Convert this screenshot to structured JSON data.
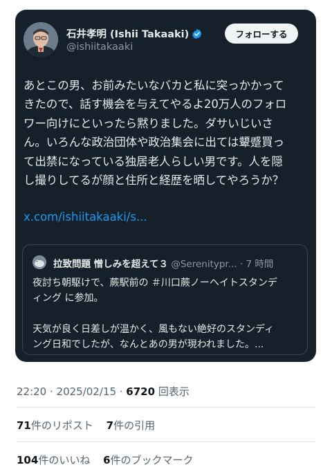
{
  "tweet": {
    "author": {
      "name": "石井孝明 (Ishii Takaaki)",
      "handle": "@ishiitakaaki",
      "verified_icon": "verified-badge-icon"
    },
    "follow_label": "フォローする",
    "text": "あとこの男、お前みたいなバカと私に突っかかって\nきたので、話す機会を与えてやるよ20万人のフォロ\nワー向けにといったら黙りました。ダサいじいさ\nん。いろんな政治団体や政治集会に出ては顰蹙買っ\nて出禁になっている独居老人らしい男です。人を隠\nし撮りしてるが顔と住所と経歴を晒してやろうか？",
    "link": "x.com/ishiitakaaki/s...",
    "quote": {
      "name": "拉致問題 憎しみを超えて３",
      "handle": "@Serenitypr...",
      "separator": "·",
      "time": "7 時間",
      "text": "夜討ち朝駆けで、蕨駅前の ＃川口蕨ノーヘイトスタンデ\nィング に参加。\n\n天気が良く日差しが温かく、風もない絶好のスタンディ\nング日和でしたが、なんとあの男が現われました。..."
    },
    "timestamp": "22:20 · 2025/02/15 · ",
    "views_count": "6720",
    "views_label": " 回表示",
    "reposts_count": "71",
    "reposts_label": "件のリポスト",
    "quotes_count": "7",
    "quotes_label": "件の引用",
    "likes_count": "104",
    "likes_label": "件のいいね",
    "bookmarks_count": "6",
    "bookmarks_label": "件のブックマーク"
  },
  "colors": {
    "card_bg": "#15202b",
    "link": "#1d9bf0",
    "verified": "#1d9bf0",
    "muted": "#8b98a5"
  }
}
